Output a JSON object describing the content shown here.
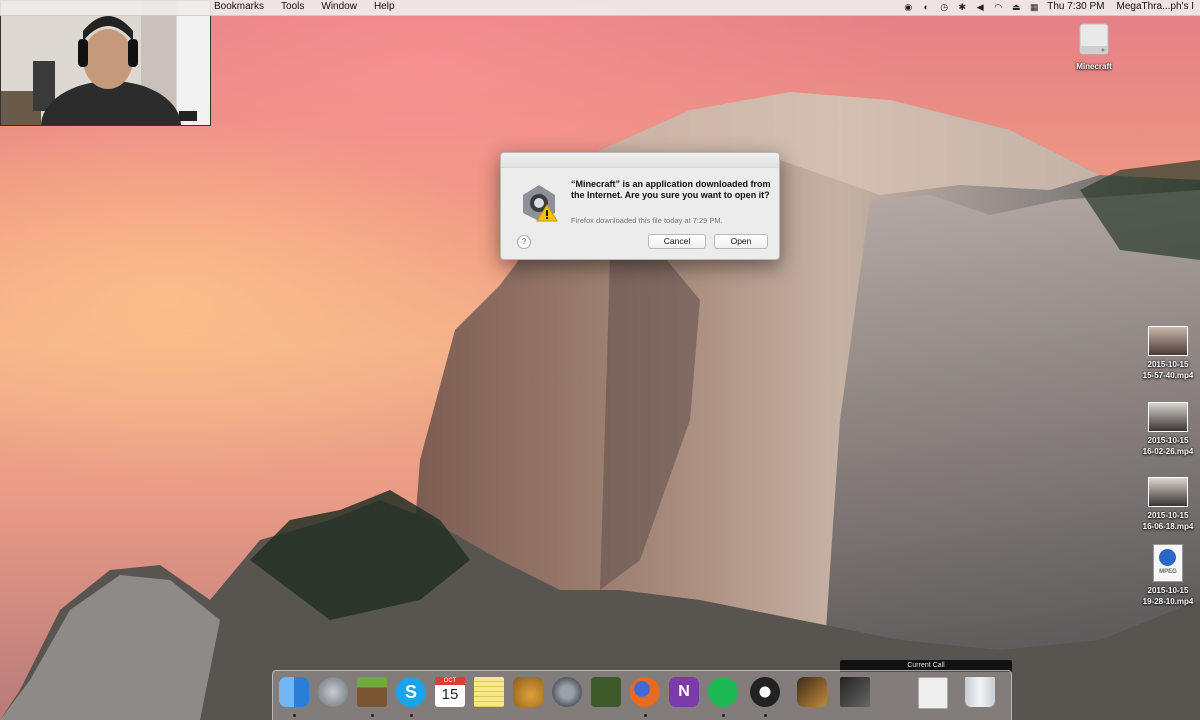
{
  "menubar": {
    "menus": [
      "Bookmarks",
      "Tools",
      "Window",
      "Help"
    ],
    "clock": "Thu 7:30 PM",
    "user": "MegaThra...ph's I"
  },
  "desktop": {
    "drive_label": "Minecraft",
    "files": [
      {
        "name_line1": "2015-10-15",
        "name_line2": "15-57-40.mp4"
      },
      {
        "name_line1": "2015-10-15",
        "name_line2": "16-02-26.mp4"
      },
      {
        "name_line1": "2015-10-15",
        "name_line2": "16-06-18.mp4"
      },
      {
        "name_line1": "2015-10-15",
        "name_line2": "19-28-10.mp4"
      }
    ],
    "mpeg_badge": "MPEG"
  },
  "dialog": {
    "message": "“Minecraft” is an application downloaded from the Internet. Are you sure you want to open it?",
    "detail": "Firefox downloaded this file today at 7:29 PM.",
    "help": "?",
    "cancel_label": "Cancel",
    "open_label": "Open"
  },
  "dock": {
    "calendar_month": "OCT",
    "calendar_day": "15",
    "current_call": "Current Call",
    "apps": [
      {
        "name": "Finder",
        "color": "#3d8fe8"
      },
      {
        "name": "Launchpad",
        "color": "#8a8f99"
      },
      {
        "name": "Minecraft",
        "color": "#6b9a3a"
      },
      {
        "name": "Skype",
        "color": "#1aa3e8"
      },
      {
        "name": "Calendar",
        "color": "#ffffff"
      },
      {
        "name": "Notes",
        "color": "#f5e27a"
      },
      {
        "name": "Fruit",
        "color": "#d89a3c"
      },
      {
        "name": "System Preferences",
        "color": "#7a7f88"
      },
      {
        "name": "Blender-like",
        "color": "#4e6a3a"
      },
      {
        "name": "Firefox",
        "color": "#e66a1f"
      },
      {
        "name": "OneNote",
        "color": "#7a3aa8"
      },
      {
        "name": "Spotify",
        "color": "#1db954"
      },
      {
        "name": "OBS",
        "color": "#222222"
      },
      {
        "name": "Guitar",
        "color": "#a66b2a"
      },
      {
        "name": "Final Cut",
        "color": "#444444"
      },
      {
        "name": "Document",
        "color": "#e9e9e9"
      },
      {
        "name": "Trash",
        "color": "#d9dde2"
      }
    ]
  }
}
